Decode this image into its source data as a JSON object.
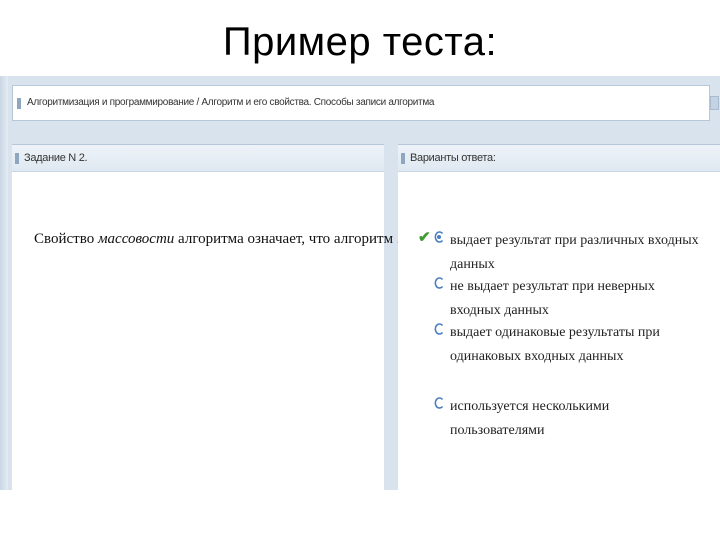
{
  "slide": {
    "title": "Пример теста:"
  },
  "topic_bar": {
    "text": "Алгоритмизация и программирование / Алгоритм и его свойства. Способы записи алгоритма"
  },
  "task_panel": {
    "header": "Задание N 2.",
    "question_prefix": "Свойство ",
    "question_emphasis": "массовости",
    "question_suffix": " алгоритма означает, что алгоритм ..."
  },
  "answer_panel": {
    "header": "Варианты ответа:",
    "options": [
      {
        "label": "выдает результат при различных входных данных",
        "selected": true
      },
      {
        "label": "не выдает результат при неверных входных данных",
        "selected": false
      },
      {
        "label": "выдает одинаковые результаты при одинаковых входных данных",
        "selected": false
      },
      {
        "label": "используется несколькими пользователями",
        "selected": false
      }
    ]
  },
  "colors": {
    "frame": "#d8e3ee",
    "radio": "#4a7fc1",
    "check": "#3e9b2f"
  }
}
